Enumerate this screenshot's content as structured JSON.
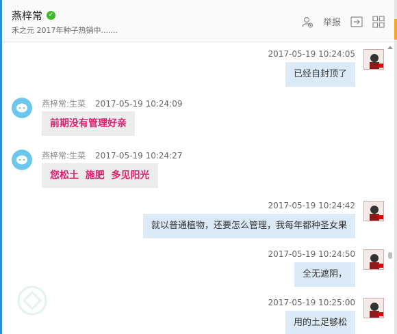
{
  "header": {
    "title": "燕梓常",
    "subtitle": "禾之元 2017年种子热销中.......",
    "report_label": "举报",
    "accent_color": "#2d8fd5",
    "verified_color": "#3fba2b"
  },
  "messages": [
    {
      "direction": "out",
      "timestamp": "2017-05-19 10:24:05",
      "text": "已经自封顶了"
    },
    {
      "direction": "in",
      "sender": "燕梓常:生菜",
      "timestamp": "2017-05-19 10:24:09",
      "text": "前期没有管理好亲"
    },
    {
      "direction": "in",
      "sender": "燕梓常:生菜",
      "timestamp": "2017-05-19 10:24:27",
      "text": "您松土  施肥  多见阳光"
    },
    {
      "direction": "out",
      "timestamp": "2017-05-19 10:24:42",
      "text": "就以普通植物，还要怎么管理，我每年都种圣女果"
    },
    {
      "direction": "out",
      "timestamp": "2017-05-19 10:24:50",
      "text": "全无遮阴，"
    },
    {
      "direction": "out",
      "timestamp": "2017-05-19 10:25:00",
      "text": "用的土足够松"
    }
  ]
}
